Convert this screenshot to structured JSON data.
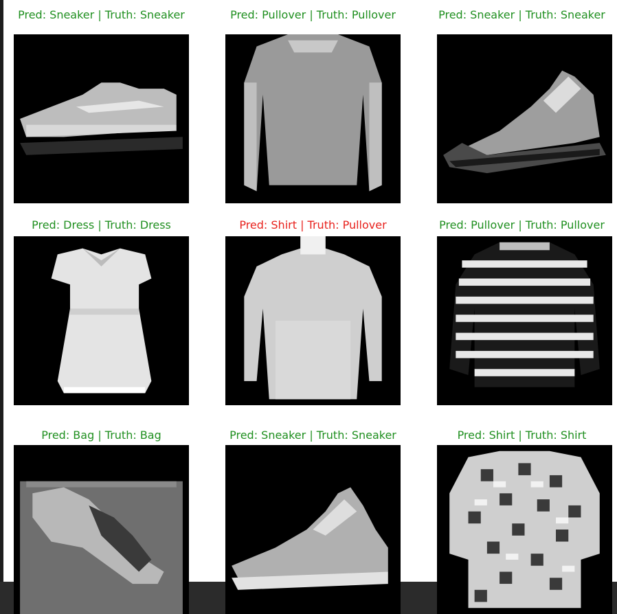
{
  "panels": [
    {
      "pred": "Sneaker",
      "truth": "Sneaker",
      "correct": true,
      "title": "Pred: Sneaker | Truth: Sneaker",
      "icon": "sneaker-image"
    },
    {
      "pred": "Pullover",
      "truth": "Pullover",
      "correct": true,
      "title": "Pred: Pullover | Truth: Pullover",
      "icon": "pullover-image"
    },
    {
      "pred": "Sneaker",
      "truth": "Sneaker",
      "correct": true,
      "title": "Pred: Sneaker | Truth: Sneaker",
      "icon": "sneaker-image"
    },
    {
      "pred": "Dress",
      "truth": "Dress",
      "correct": true,
      "title": "Pred: Dress | Truth: Dress",
      "icon": "dress-image"
    },
    {
      "pred": "Shirt",
      "truth": "Pullover",
      "correct": false,
      "title": "Pred: Shirt | Truth: Pullover",
      "icon": "shirt-image"
    },
    {
      "pred": "Pullover",
      "truth": "Pullover",
      "correct": true,
      "title": "Pred: Pullover | Truth: Pullover",
      "icon": "striped-pullover-image"
    },
    {
      "pred": "Bag",
      "truth": "Bag",
      "correct": true,
      "title": "Pred: Bag | Truth: Bag",
      "icon": "bag-image"
    },
    {
      "pred": "Sneaker",
      "truth": "Sneaker",
      "correct": true,
      "title": "Pred: Sneaker | Truth: Sneaker",
      "icon": "sneaker-image"
    },
    {
      "pred": "Shirt",
      "truth": "Shirt",
      "correct": true,
      "title": "Pred: Shirt | Truth: Shirt",
      "icon": "shirt-image"
    }
  ],
  "colors": {
    "correct": "#1f8f1f",
    "incorrect": "#e8211c",
    "image_bg": "#000000"
  }
}
